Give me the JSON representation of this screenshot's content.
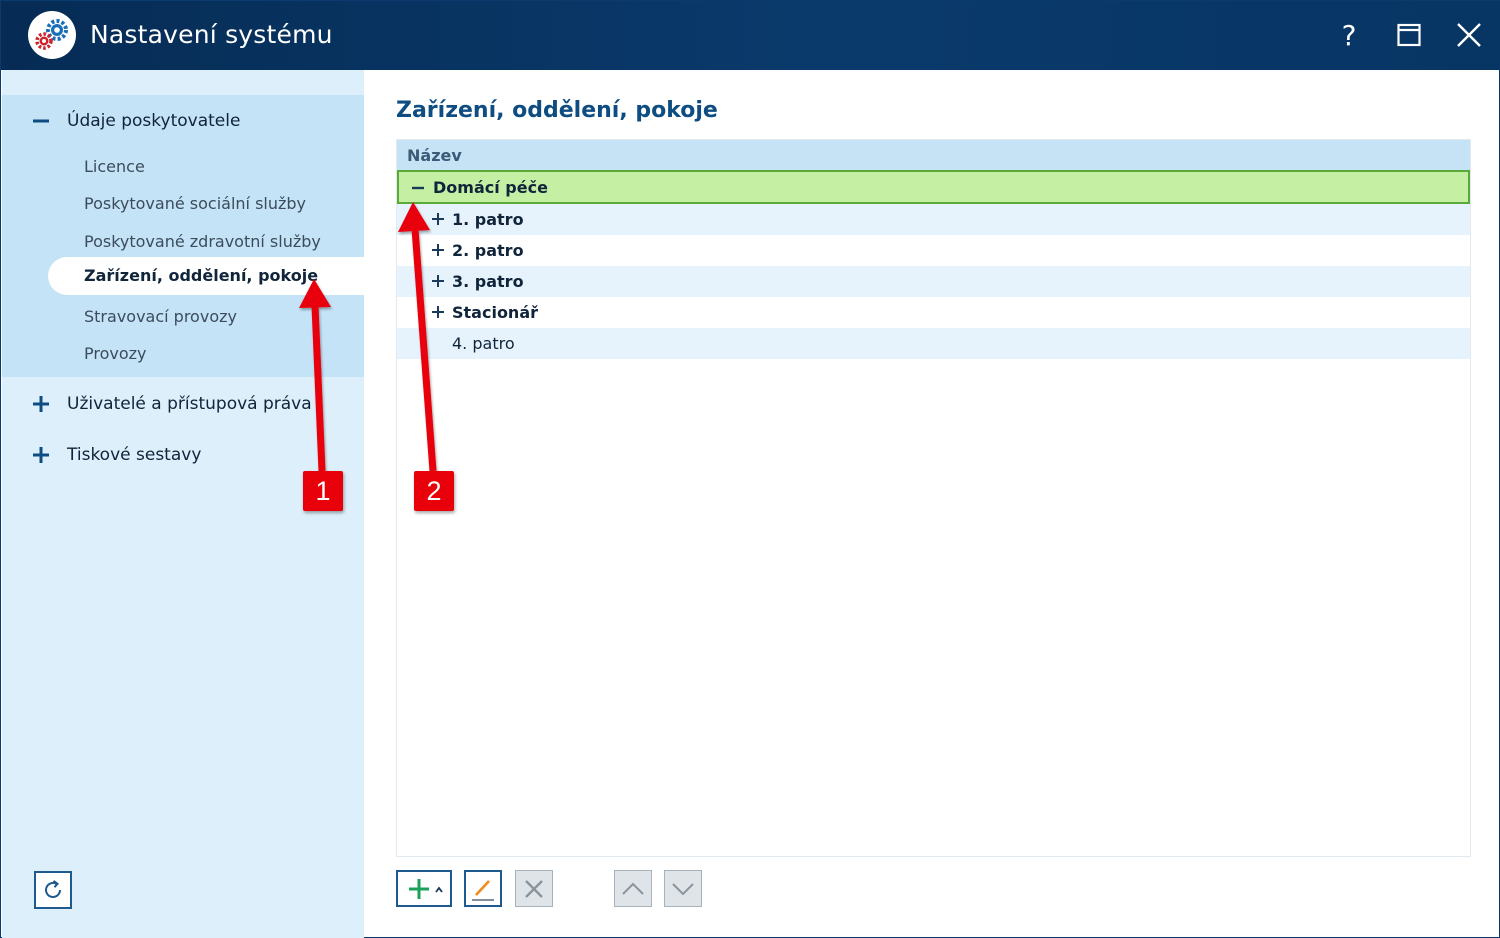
{
  "window": {
    "title": "Nastavení systému",
    "help_label": "?"
  },
  "sidebar": {
    "groups": [
      {
        "label": "Údaje poskytovatele",
        "expanded": true,
        "items": [
          {
            "label": "Licence"
          },
          {
            "label": "Poskytované sociální služby"
          },
          {
            "label": "Poskytované zdravotní služby"
          },
          {
            "label": "Zařízení, oddělení, pokoje",
            "active": true
          },
          {
            "label": "Stravovací provozy"
          },
          {
            "label": "Provozy"
          }
        ]
      },
      {
        "label": "Uživatelé a přístupová práva",
        "expanded": false
      },
      {
        "label": "Tiskové sestavy",
        "expanded": false
      }
    ]
  },
  "main": {
    "title": "Zařízení, oddělení, pokoje",
    "tree": {
      "column_header": "Název",
      "rows": [
        {
          "label": "Domácí péče",
          "expander": "minus",
          "level": 0,
          "selected": true
        },
        {
          "label": "1. patro",
          "expander": "plus",
          "level": 1
        },
        {
          "label": "2. patro",
          "expander": "plus",
          "level": 1
        },
        {
          "label": "3. patro",
          "expander": "plus",
          "level": 1
        },
        {
          "label": "Stacionář",
          "expander": "plus",
          "level": 1
        },
        {
          "label": "4. patro",
          "expander": "none",
          "level": 1
        }
      ]
    }
  },
  "toolbar": {
    "buttons": [
      "add-icon",
      "edit-icon",
      "delete-icon",
      "move-up-icon",
      "move-down-icon"
    ]
  },
  "annotations": {
    "callout_1": "1",
    "callout_2": "2"
  },
  "colors": {
    "titlebar": "#0a3a6c",
    "sidebar_bg": "#ddeffa",
    "sidebar_group_bg": "#c4e3f6",
    "selected_row": "#c5f0a4",
    "selected_border": "#5aaa3a",
    "accent_text": "#0e4d82",
    "callout": "#e8000a"
  }
}
